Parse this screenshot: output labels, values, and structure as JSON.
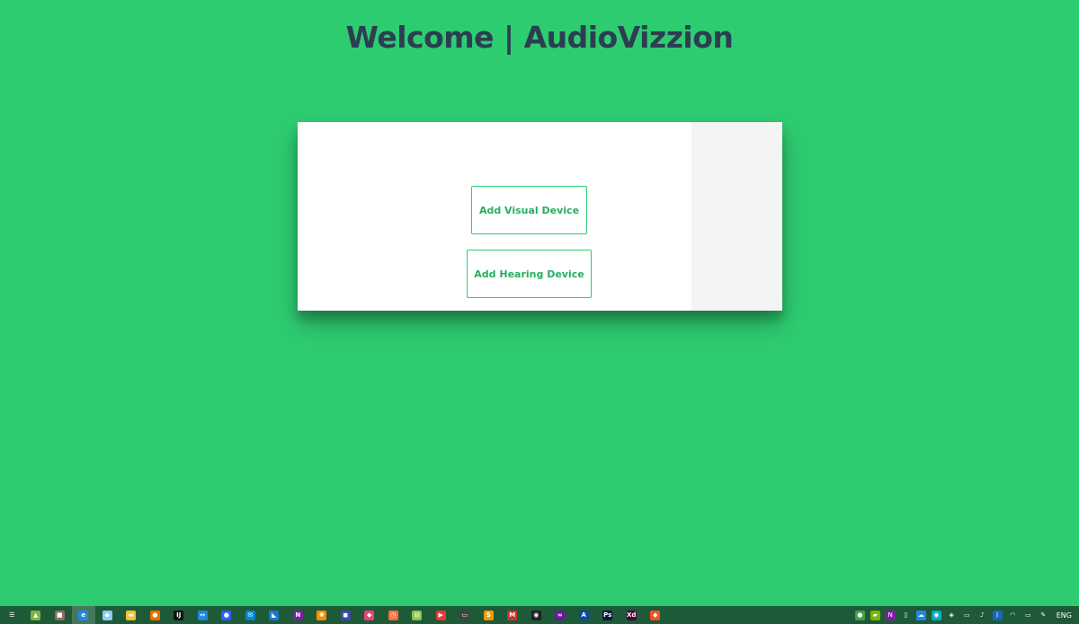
{
  "page": {
    "title": "Welcome | AudioVizzion",
    "background_color": "#2ecc71",
    "title_color": "#2c3e50"
  },
  "card": {
    "visual_button_label": "Add Visual Device",
    "hearing_button_label": "Add Hearing Device",
    "button_text_color": "#27ae60",
    "button_border_color": "#2ecc71"
  },
  "taskbar": {
    "apps": [
      {
        "name": "task-view-icon",
        "glyph": "☰",
        "color": "transparent"
      },
      {
        "name": "android-studio-icon",
        "glyph": "▲",
        "color": "#7cb342"
      },
      {
        "name": "store-icon",
        "glyph": "■",
        "color": "#8d6e63"
      },
      {
        "name": "edge-icon",
        "glyph": "e",
        "color": "#1e88e5"
      },
      {
        "name": "paint-icon",
        "glyph": "◆",
        "color": "#90caf9"
      },
      {
        "name": "file-explorer-icon",
        "glyph": "▬",
        "color": "#fbc02d"
      },
      {
        "name": "postman-icon",
        "glyph": "●",
        "color": "#ef6c00"
      },
      {
        "name": "intellij-icon",
        "glyph": "IJ",
        "color": "#111111"
      },
      {
        "name": "teamviewer-icon",
        "glyph": "↔",
        "color": "#1e88e5"
      },
      {
        "name": "signal-icon",
        "glyph": "●",
        "color": "#2962ff"
      },
      {
        "name": "mail-icon",
        "glyph": "✉",
        "color": "#0288d1"
      },
      {
        "name": "vscode-icon",
        "glyph": "◣",
        "color": "#1976d2"
      },
      {
        "name": "onenote-icon",
        "glyph": "N",
        "color": "#7b1fa2"
      },
      {
        "name": "blender-icon",
        "glyph": "✺",
        "color": "#ff8f00"
      },
      {
        "name": "virtualbox-icon",
        "glyph": "◼",
        "color": "#3949ab"
      },
      {
        "name": "app-icon",
        "glyph": "◆",
        "color": "#ec407a"
      },
      {
        "name": "clock-icon",
        "glyph": "◷",
        "color": "#ff7043"
      },
      {
        "name": "notepad-icon",
        "glyph": "▤",
        "color": "#8bc34a"
      },
      {
        "name": "youtube-icon",
        "glyph": "▶",
        "color": "#e53935"
      },
      {
        "name": "terminal-icon",
        "glyph": "▭",
        "color": "#424242"
      },
      {
        "name": "sublime-icon",
        "glyph": "S",
        "color": "#ff9800"
      },
      {
        "name": "gmail-icon",
        "glyph": "M",
        "color": "#d32f2f"
      },
      {
        "name": "github-icon",
        "glyph": "◉",
        "color": "#212121"
      },
      {
        "name": "visual-studio-icon",
        "glyph": "∞",
        "color": "#6a1b9a"
      },
      {
        "name": "azure-icon",
        "glyph": "A",
        "color": "#0d47a1"
      },
      {
        "name": "photoshop-icon",
        "glyph": "Ps",
        "color": "#0a1b3d"
      },
      {
        "name": "xd-icon",
        "glyph": "Xd",
        "color": "#470137"
      },
      {
        "name": "git-icon",
        "glyph": "◆",
        "color": "#f4511e"
      }
    ],
    "tray": [
      {
        "name": "tray-app-icon",
        "glyph": "●",
        "color": "#43a047"
      },
      {
        "name": "nvidia-icon",
        "glyph": "▰",
        "color": "#76b900"
      },
      {
        "name": "onenote-tray-icon",
        "glyph": "N",
        "color": "#7b1fa2"
      },
      {
        "name": "usb-icon",
        "glyph": "▯",
        "color": "transparent"
      },
      {
        "name": "cloud-icon",
        "glyph": "☁",
        "color": "#1e88e5"
      },
      {
        "name": "network-app-icon",
        "glyph": "◉",
        "color": "#00acc1"
      },
      {
        "name": "defender-icon",
        "glyph": "◈",
        "color": "transparent"
      },
      {
        "name": "display-icon",
        "glyph": "▭",
        "color": "transparent"
      },
      {
        "name": "volume-icon",
        "glyph": "♪",
        "color": "transparent"
      },
      {
        "name": "bluetooth-icon",
        "glyph": "ᛒ",
        "color": "#1565c0"
      },
      {
        "name": "wifi-icon",
        "glyph": "◠",
        "color": "transparent"
      },
      {
        "name": "battery-icon",
        "glyph": "▭",
        "color": "transparent"
      },
      {
        "name": "pen-icon",
        "glyph": "✎",
        "color": "transparent"
      }
    ],
    "language": "ENG"
  }
}
